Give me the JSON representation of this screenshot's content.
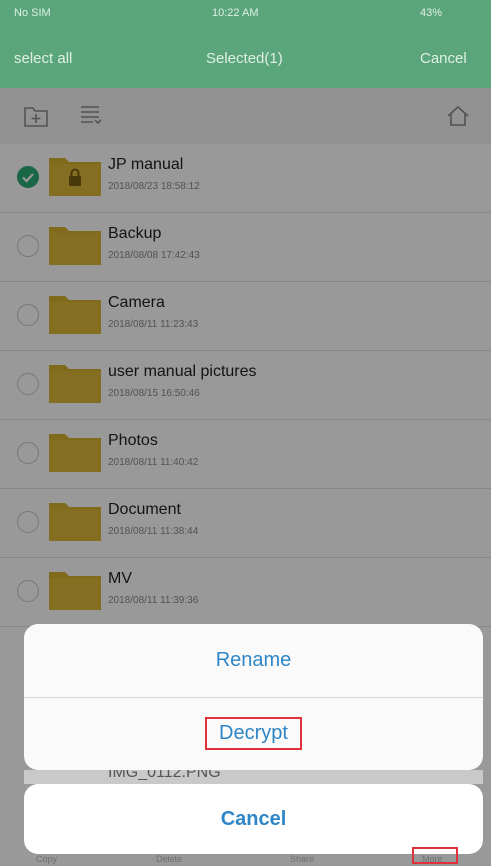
{
  "status_bar": {
    "carrier": "No SIM",
    "time": "10:22 AM",
    "battery": "43%"
  },
  "nav": {
    "select_all": "select all",
    "title": "Selected(1)",
    "cancel": "Cancel"
  },
  "toolbar": {
    "icons": [
      "new-folder-icon",
      "list-icon",
      "home-icon"
    ]
  },
  "files": [
    {
      "name": "JP manual",
      "date": "2018/08/23 18:58:12",
      "selected": true,
      "locked": true
    },
    {
      "name": "Backup",
      "date": "2018/08/08 17:42:43",
      "selected": false,
      "locked": false
    },
    {
      "name": "Camera",
      "date": "2018/08/11 11:23:43",
      "selected": false,
      "locked": false
    },
    {
      "name": "user manual pictures",
      "date": "2018/08/15 16:50:46",
      "selected": false,
      "locked": false
    },
    {
      "name": "Photos",
      "date": "2018/08/11 11:40:42",
      "selected": false,
      "locked": false
    },
    {
      "name": "Document",
      "date": "2018/08/11 11:38:44",
      "selected": false,
      "locked": false
    },
    {
      "name": "MV",
      "date": "2018/08/11 11:39:36",
      "selected": false,
      "locked": false
    }
  ],
  "hidden_item": "IMG_0112.PNG",
  "action_sheet": {
    "rename": "Rename",
    "decrypt": "Decrypt",
    "cancel": "Cancel"
  },
  "tab_bar": [
    "Copy",
    "Delete",
    "Share",
    "More"
  ],
  "colors": {
    "header": "#5aa67a",
    "accent": "#2f86c7",
    "check": "#2eaa77",
    "highlight": "#e0323c",
    "folder": "#d6b12e"
  }
}
